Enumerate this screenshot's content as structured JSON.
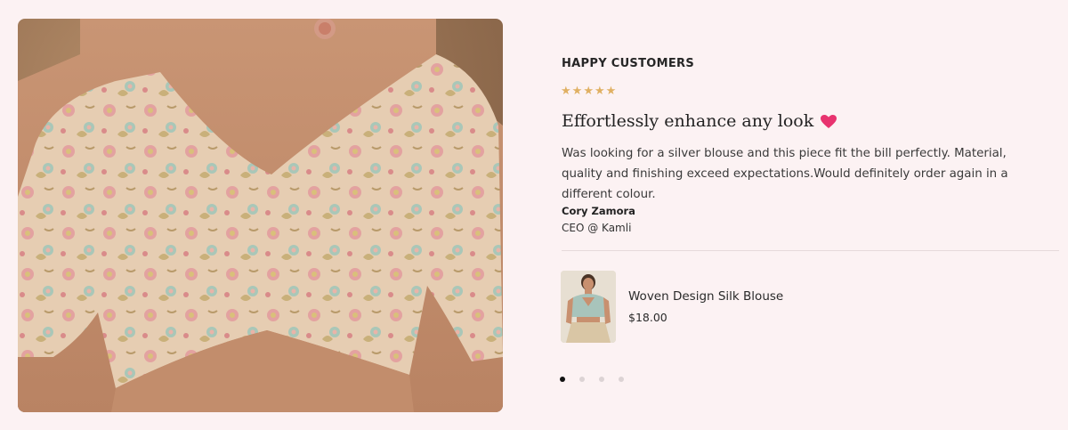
{
  "testimonial": {
    "section_title": "HAPPY CUSTOMERS",
    "rating": 5,
    "rating_max": 5,
    "star_icon": "star-icon",
    "headline": "Effortlessly enhance any look",
    "headline_icon": "heart-icon",
    "review": "Was looking for a silver blouse and this piece fit the bill perfectly. Material, quality and finishing exceed expectations.Would definitely order again in a different colour.",
    "author_name": "Cory Zamora",
    "author_title": "CEO @ Kamli"
  },
  "product": {
    "name": "Woven Design Silk Blouse",
    "price": "$18.00"
  },
  "carousel": {
    "slide_count": 4,
    "active_index": 0
  },
  "colors": {
    "background": "#fcf2f3",
    "star": "#e0b062",
    "heart": "#e8336f",
    "active_dot": "#111111"
  }
}
